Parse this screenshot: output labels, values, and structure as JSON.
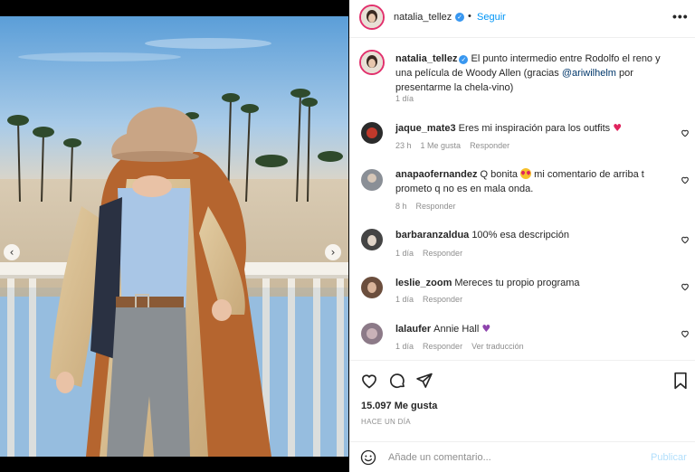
{
  "post": {
    "username": "natalia_tellez",
    "follow_label": "Seguir",
    "separator": "•",
    "more_label": "•••",
    "caption_text": "El punto intermedio entre Rodolfo el reno y una película de Woody Allen (gracias ",
    "caption_mention": "@ariwilhelm",
    "caption_tail": " por presentarme la chela-vino)",
    "caption_time": "1 día",
    "likes": "15.097 Me gusta",
    "posted_ago": "HACE UN DÍA",
    "carousel": {
      "slides": 5,
      "active_index": 1
    }
  },
  "comments": [
    {
      "user": "jaque_mate3",
      "text": "Eres mi inspiración para los outfits",
      "emoji": "heart",
      "time": "23 h",
      "likes": "1 Me gusta",
      "reply": "Responder",
      "translate": ""
    },
    {
      "user": "anapaofernandez",
      "text": "Q bonita",
      "emoji": "heart-eyes",
      "text_after": " mi comentario de arriba t prometo q no es en mala onda.",
      "time": "8 h",
      "likes": "",
      "reply": "Responder",
      "translate": ""
    },
    {
      "user": "barbaranzaldua",
      "text": "100% esa descripción",
      "time": "1 día",
      "likes": "",
      "reply": "Responder",
      "translate": ""
    },
    {
      "user": "leslie_zoom",
      "text": "Mereces tu propio programa",
      "time": "1 día",
      "likes": "",
      "reply": "Responder",
      "translate": ""
    },
    {
      "user": "lalaufer",
      "text": "Annie Hall",
      "emoji": "purple-heart",
      "time": "1 día",
      "likes": "",
      "reply": "Responder",
      "translate": "Ver traducción"
    }
  ],
  "composer": {
    "placeholder": "Añade un comentario...",
    "publish_label": "Publicar"
  },
  "icons": {
    "like": "heart-outline-icon",
    "comment": "comment-bubble-icon",
    "share": "paper-plane-icon",
    "save": "bookmark-icon",
    "emoji": "smiley-icon",
    "prev": "chevron-left-icon",
    "next": "chevron-right-icon"
  },
  "colors": {
    "accent": "#0095f6",
    "verified": "#3897f0",
    "muted": "#8e8e8e",
    "publish_disabled": "#b2dffc"
  }
}
